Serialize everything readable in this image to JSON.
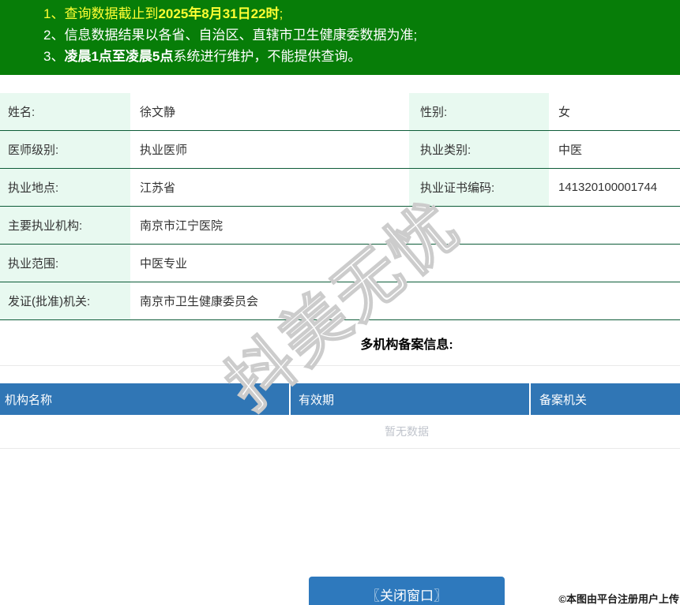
{
  "colors": {
    "banner_green": "#077d08",
    "banner_yellow": "#ffff33",
    "mint": "#e8f9f0",
    "divider_green": "#0d5c38",
    "light_divider": "#e9e9e9",
    "header_blue": "#3076b5",
    "button_blue": "#2e79bd",
    "empty_gray": "#c0c4cc"
  },
  "banner": {
    "lines": [
      {
        "num": "1、",
        "t": "查询数据截止到",
        "b": "2025年8月31日22时",
        "t2": ";"
      },
      {
        "num": "2、",
        "t": "信息数据结果以各省、自治区、直辖市卫生健康委数据为准;",
        "b": "",
        "t2": ""
      },
      {
        "num": "3、",
        "t": "",
        "b": "凌晨1点至凌晨5点",
        "t2": "系统进行维护，不能提供查询。"
      }
    ]
  },
  "info": {
    "rows": [
      {
        "label1": "姓名:",
        "value1": "徐文静",
        "label2": "性别:",
        "value2": "女"
      },
      {
        "label1": "医师级别:",
        "value1": "执业医师",
        "label2": "执业类别:",
        "value2": "中医"
      },
      {
        "label1": "执业地点:",
        "value1": "江苏省",
        "label2": "执业证书编码:",
        "value2": "141320100001744"
      },
      {
        "label1": "主要执业机构:",
        "value1": "南京市江宁医院"
      },
      {
        "label1": "执业范围:",
        "value1": "中医专业"
      },
      {
        "label1": "发证(批准)机关:",
        "value1": "南京市卫生健康委员会"
      }
    ]
  },
  "records": {
    "title": "多机构备案信息:",
    "columns": [
      "机构名称",
      "有效期",
      "备案机关"
    ],
    "empty_text": "暂无数据"
  },
  "footer": {
    "close_label": "〖关闭窗口〗"
  },
  "watermark": "抖美无忧",
  "caption": "©本图由平台注册用户上传"
}
